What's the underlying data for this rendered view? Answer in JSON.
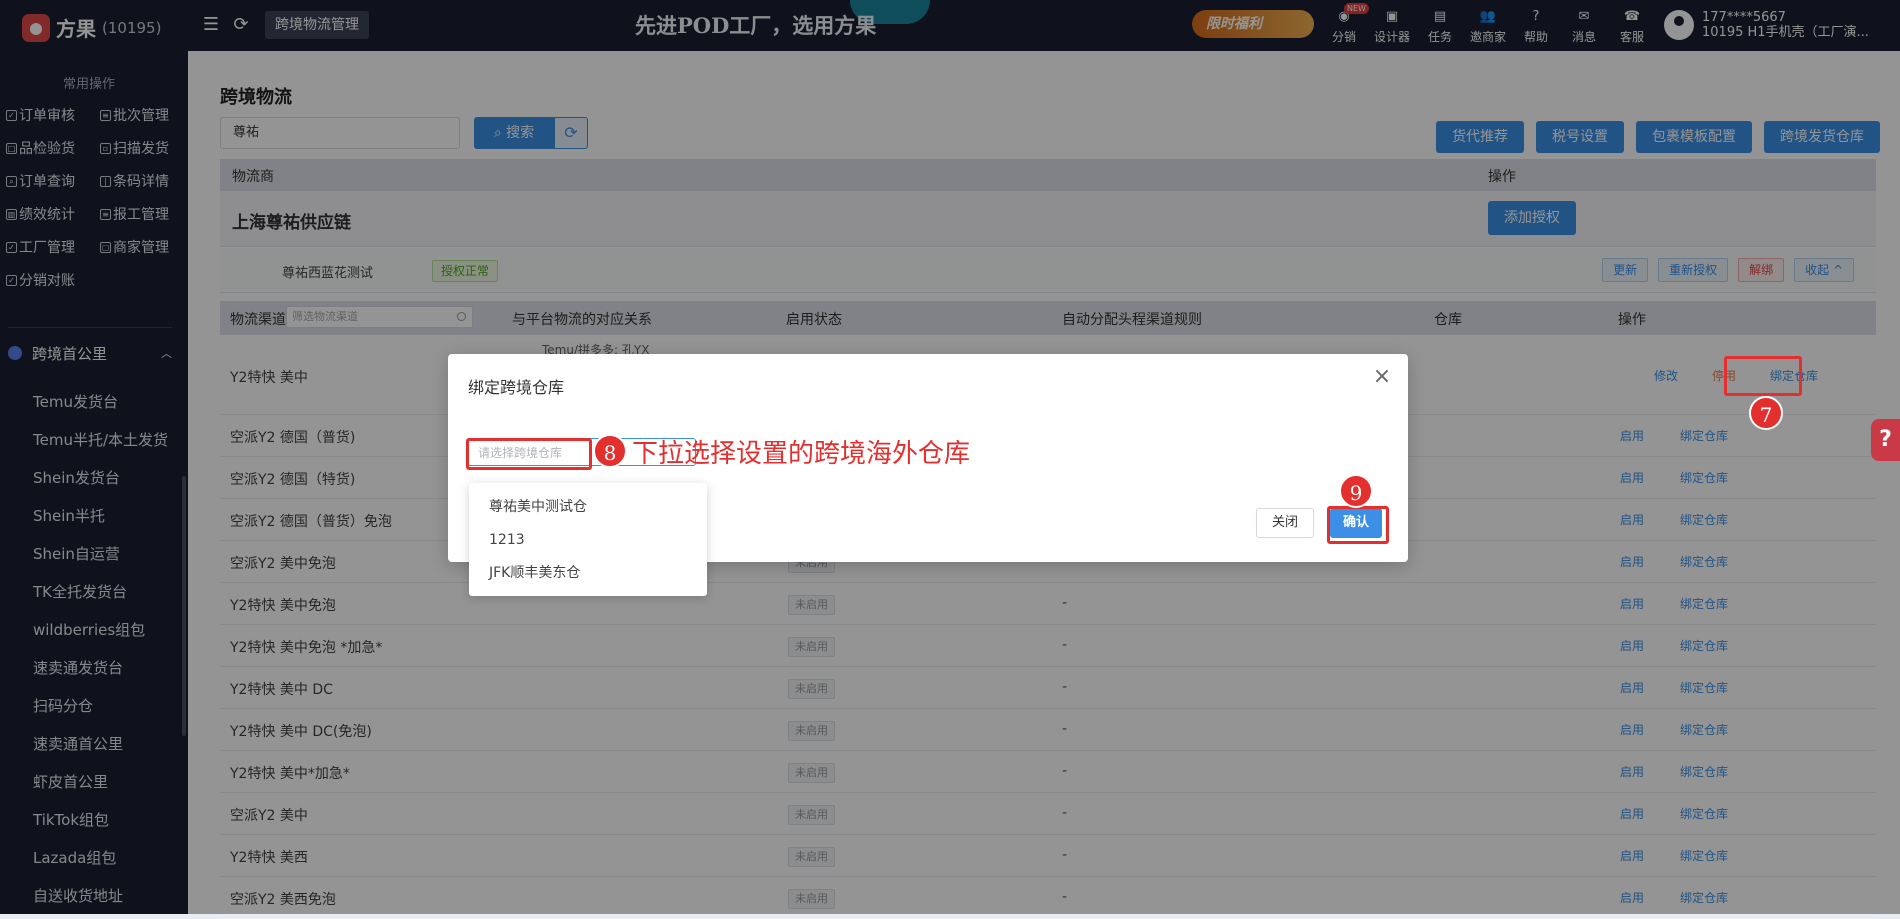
{
  "topbar": {
    "logo_name": "方果",
    "logo_id": "(10195)",
    "module_tag": "跨境物流管理",
    "slogan": "先进POD工厂，选用方果",
    "promo": "限时福利",
    "nav": [
      {
        "label": "分销",
        "icon": "share-icon",
        "badge": "NEW"
      },
      {
        "label": "设计器",
        "icon": "image-icon"
      },
      {
        "label": "任务",
        "icon": "task-icon"
      },
      {
        "label": "邀商家",
        "icon": "users-icon"
      },
      {
        "label": "帮助",
        "icon": "help-icon"
      },
      {
        "label": "消息",
        "icon": "message-icon"
      },
      {
        "label": "客服",
        "icon": "service-icon"
      }
    ],
    "user_phone": "177****5667",
    "user_shop": "10195 H1手机壳（工厂演..."
  },
  "sidebar": {
    "section_title": "常用操作",
    "quick": [
      "订单审核",
      "批次管理",
      "品检验货",
      "扫描发货",
      "订单查询",
      "条码详情",
      "绩效统计",
      "报工管理",
      "工厂管理",
      "商家管理",
      "分销对账"
    ],
    "group": "跨境首公里",
    "submenu": [
      "Temu发货台",
      "Temu半托/本土发货",
      "Shein发货台",
      "Shein半托",
      "Shein自运营",
      "TK全托发货台",
      "wildberries组包",
      "速卖通发货台",
      "扫码分仓",
      "速卖通首公里",
      "虾皮首公里",
      "TikTok组包",
      "Lazada组包",
      "自送收货地址"
    ]
  },
  "main": {
    "title": "跨境物流",
    "search_value": "尊祐",
    "search_btn": "搜索",
    "top_buttons": [
      "货代推荐",
      "税号设置",
      "包裹模板配置",
      "跨境发货仓库"
    ],
    "head1": {
      "col1": "物流商",
      "col2": "操作"
    },
    "vendor": "上海尊祐供应链",
    "add_auth": "添加授权",
    "account": "尊祐西蓝花测试",
    "auth_status": "授权正常",
    "sub_buttons": [
      "更新",
      "重新授权",
      "解绑",
      "收起 ^"
    ],
    "columns": [
      "物流渠道",
      "与平台物流的对应关系",
      "启用状态",
      "自动分配头程渠道规则",
      "仓库",
      "操作"
    ],
    "channel_filter_placeholder": "筛选物流渠道",
    "first_row": {
      "name": "Y2特快 美中",
      "mapping": "Temu/拼多多: 孔YX",
      "edit": "修改",
      "stop": "停用",
      "bind": "绑定仓库"
    },
    "rows": [
      {
        "name": "空派Y2 德国（普货)",
        "status": "",
        "dash": ""
      },
      {
        "name": "空派Y2 德国（特货)",
        "status": "",
        "dash": ""
      },
      {
        "name": "空派Y2 德国（普货）免泡",
        "status": "",
        "dash": ""
      },
      {
        "name": "空派Y2 美中免泡",
        "status": "未启用",
        "dash": "-"
      },
      {
        "name": "Y2特快 美中免泡",
        "status": "未启用",
        "dash": "-"
      },
      {
        "name": "Y2特快 美中免泡 *加急*",
        "status": "未启用",
        "dash": "-"
      },
      {
        "name": "Y2特快 美中 DC",
        "status": "未启用",
        "dash": "-"
      },
      {
        "name": "Y2特快 美中 DC(免泡)",
        "status": "未启用",
        "dash": "-"
      },
      {
        "name": "Y2特快 美中*加急*",
        "status": "未启用",
        "dash": "-"
      },
      {
        "name": "空派Y2 美中",
        "status": "未启用",
        "dash": "-"
      },
      {
        "name": "Y2特快 美西",
        "status": "未启用",
        "dash": "-"
      },
      {
        "name": "空派Y2 美西免泡",
        "status": "未启用",
        "dash": "-"
      }
    ],
    "row_link_enable": "启用",
    "row_link_bind": "绑定仓库"
  },
  "modal": {
    "title": "绑定跨境仓库",
    "select_placeholder": "请选择跨境仓库",
    "options": [
      "尊祐美中测试仓",
      "1213",
      "JFK顺丰美东仓"
    ],
    "close_btn": "关闭",
    "ok_btn": "确认"
  },
  "annotations": {
    "step7": "7",
    "step8": "8",
    "step9": "9",
    "hint": "下拉选择设置的跨境海外仓库"
  },
  "colors": {
    "primary": "#3b8fe6",
    "annotation": "#e42f2f",
    "sidebar": "#1b2033"
  }
}
